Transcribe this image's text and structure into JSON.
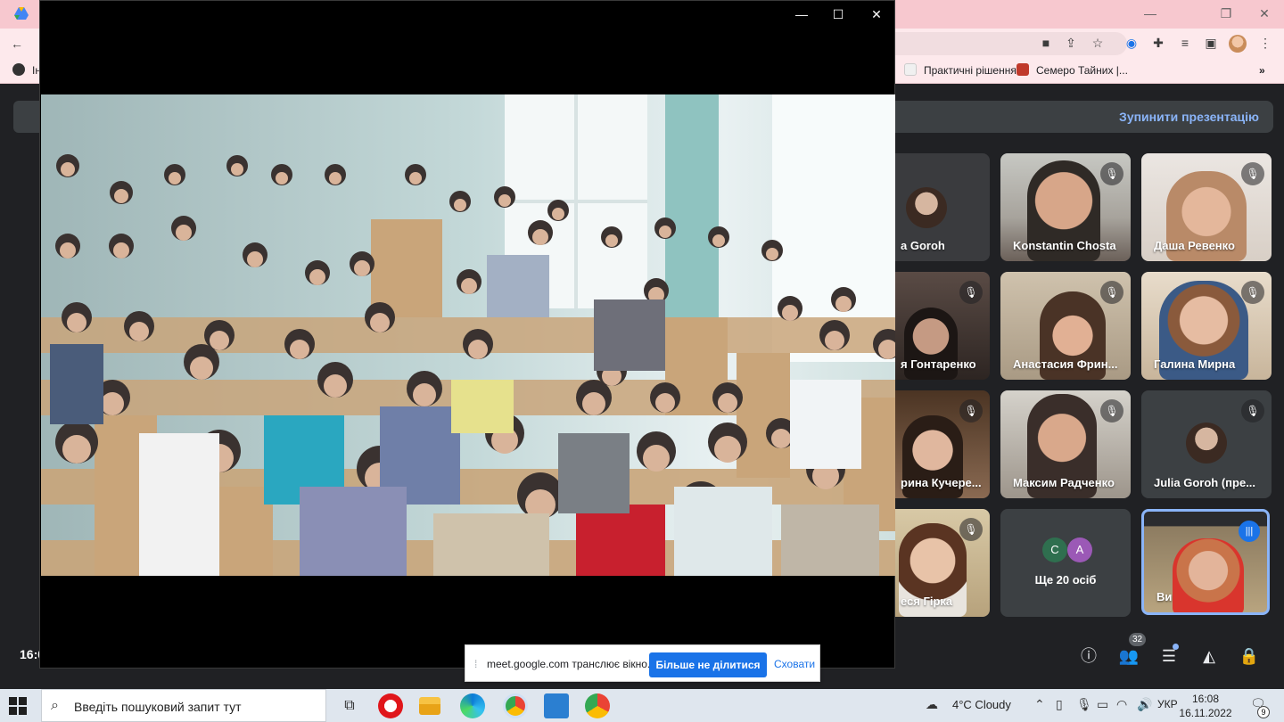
{
  "browser": {
    "bookmarks": [
      {
        "label": "Ін"
      },
      {
        "label": "Практичні рішення..."
      },
      {
        "label": "Семеро Тайних |..."
      }
    ],
    "more": "»"
  },
  "meet": {
    "stop_presenting": "Зупинити презентацію",
    "clock_partial": "16:0",
    "participants_count": "32",
    "tiles": [
      {
        "name": "a Goroh"
      },
      {
        "name": "Konstantin Chosta"
      },
      {
        "name": "Даша Ревенко"
      },
      {
        "name": "я Гонтаренко"
      },
      {
        "name": "Анастасия Фрин..."
      },
      {
        "name": "Галина Мирна"
      },
      {
        "name": "рина Кучере..."
      },
      {
        "name": "Максим Радченко"
      },
      {
        "name": "Julia Goroh (пре..."
      },
      {
        "name": "еся Гірка"
      },
      {
        "name": "Ви"
      }
    ],
    "more_tile": {
      "avatars": [
        "C",
        "A"
      ],
      "label": "Ще 20 осіб"
    }
  },
  "share_bar": {
    "text": "meet.google.com транслює вікно.",
    "stop_label": "Більше не ділитися",
    "hide_label": "Сховати"
  },
  "taskbar": {
    "search_placeholder": "Введіть пошуковий запит тут",
    "weather": "4°C  Cloudy",
    "language": "УКР",
    "time": "16:08",
    "date": "16.11.2022",
    "notifications": "9"
  },
  "colors": {
    "meet_bg": "#202124",
    "tile_bg": "#3c4043",
    "accent": "#8ab4f8",
    "button_blue": "#1a73e8",
    "tab_strip": "#f7c8cf"
  }
}
